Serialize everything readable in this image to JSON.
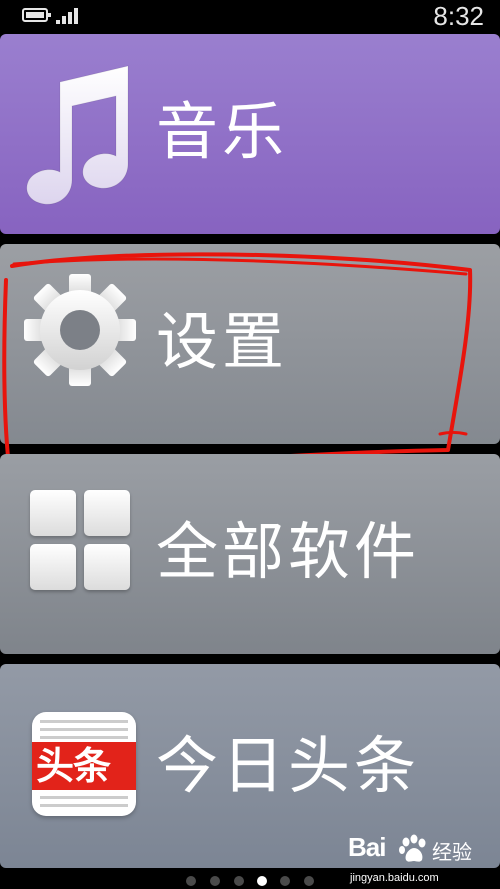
{
  "status_bar": {
    "time": "8:32",
    "battery_icon": "battery-icon",
    "signal_icon": "signal-icon"
  },
  "tiles": [
    {
      "label": "音乐",
      "icon": "music-note-icon",
      "color": "#8f6fc7"
    },
    {
      "label": "设置",
      "icon": "gear-icon",
      "color": "#8e9299"
    },
    {
      "label": "全部软件",
      "icon": "grid-icon",
      "color": "#8b8f96"
    },
    {
      "label": "今日头条",
      "icon": "toutiao-logo-icon",
      "color": "#8790a0",
      "icon_text": "头条"
    }
  ],
  "annotation": {
    "color": "#e8140c"
  },
  "pager": {
    "total": 6,
    "active": 4
  },
  "watermark": {
    "brand": "Bai",
    "product": "经验",
    "url": "jingyan.baidu.com"
  }
}
